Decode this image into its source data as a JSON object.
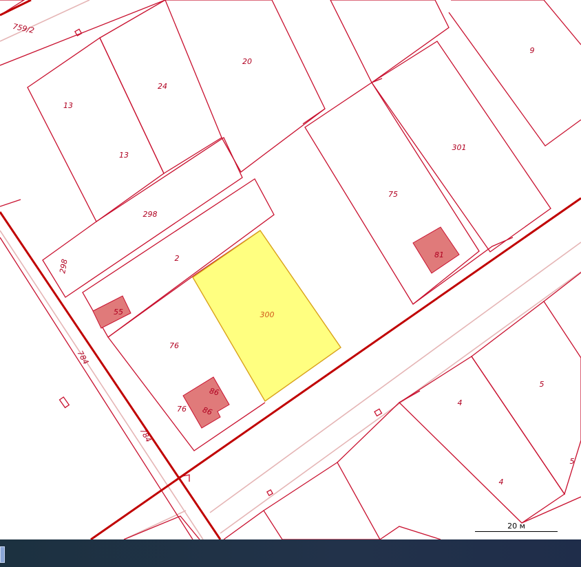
{
  "map": {
    "parcel_labels": [
      {
        "id": "p-759-2",
        "text": "759/2"
      },
      {
        "id": "p-20",
        "text": "20"
      },
      {
        "id": "p-9",
        "text": "9"
      },
      {
        "id": "p-13a",
        "text": "13"
      },
      {
        "id": "p-24",
        "text": "24"
      },
      {
        "id": "p-13b",
        "text": "13"
      },
      {
        "id": "p-301",
        "text": "301"
      },
      {
        "id": "p-298a",
        "text": "298"
      },
      {
        "id": "p-298b",
        "text": "298"
      },
      {
        "id": "p-75",
        "text": "75"
      },
      {
        "id": "p-2",
        "text": "2"
      },
      {
        "id": "p-81",
        "text": "81"
      },
      {
        "id": "p-300",
        "text": "300"
      },
      {
        "id": "p-55",
        "text": "55"
      },
      {
        "id": "p-76a",
        "text": "76"
      },
      {
        "id": "p-784a",
        "text": "784"
      },
      {
        "id": "p-86a",
        "text": "86"
      },
      {
        "id": "p-76b",
        "text": "76"
      },
      {
        "id": "p-86b",
        "text": "86"
      },
      {
        "id": "p-784b",
        "text": "784"
      },
      {
        "id": "p-4a",
        "text": "4"
      },
      {
        "id": "p-5a",
        "text": "5"
      },
      {
        "id": "p-4b",
        "text": "4"
      },
      {
        "id": "p-5b",
        "text": "5"
      }
    ],
    "selected_parcel": "300",
    "colors": {
      "boundary": "#c8102e",
      "selected_fill": "#ffff80",
      "building_fill": "#e07a7a",
      "road_line": "#e5b5b5"
    }
  },
  "scale": {
    "label": "20 м"
  }
}
